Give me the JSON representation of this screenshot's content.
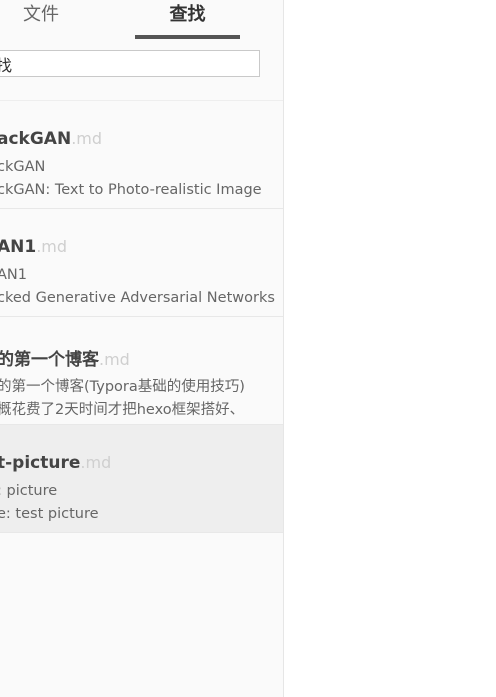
{
  "tabs": {
    "files_label": "文件",
    "search_label": "查找"
  },
  "search": {
    "value": "找"
  },
  "results": [
    {
      "title": "ackGAN",
      "ext": ".md",
      "line1": "ckGAN",
      "line2": "ckGAN: Text to Photo-realistic Image"
    },
    {
      "title": "AN1",
      "ext": ".md",
      "line1": "AN1",
      "line2": "cked Generative Adversarial Networks"
    },
    {
      "title": "的第一个博客",
      "ext": ".md",
      "line1": "的第一个博客(Typora基础的使用技巧)",
      "line2": "概花费了2天时间才把hexo框架搭好、"
    },
    {
      "title": "t-picture",
      "ext": ".md",
      "line1": ": picture",
      "line2": "e: test picture"
    }
  ],
  "colors": {
    "sidebar_bg": "#fafafa",
    "active_item_bg": "#eeeeee",
    "tab_underline": "#555555"
  }
}
